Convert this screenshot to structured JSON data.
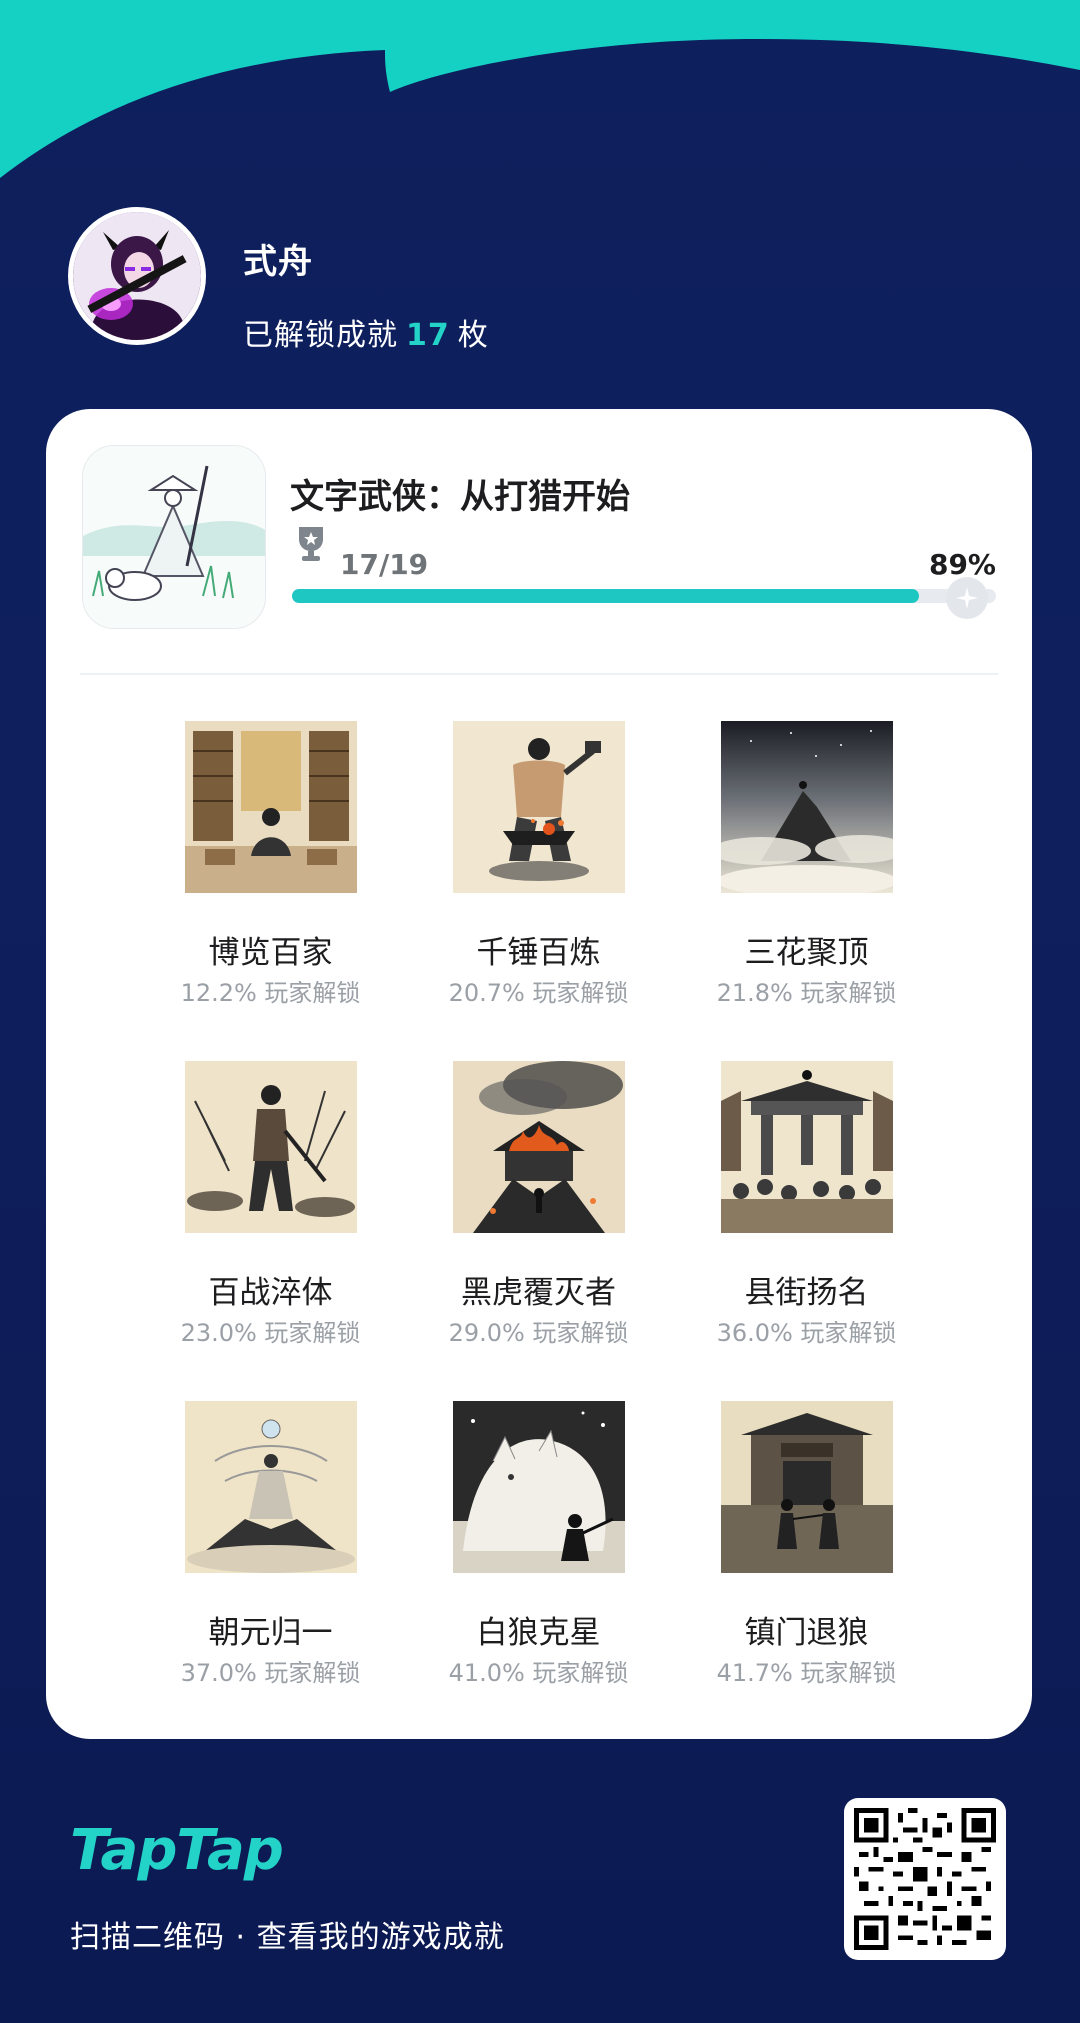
{
  "profile": {
    "username": "式舟",
    "unlocked_prefix": "已解锁成就",
    "unlocked_count": "17",
    "unlocked_suffix": "枚"
  },
  "game": {
    "title": "文字武侠：从打猎开始",
    "progress_text": "17/19",
    "progress_percent_text": "89%",
    "progress_fraction": 0.89
  },
  "achievements": [
    {
      "name": "博览百家",
      "rate": "12.2% 玩家解锁",
      "icon": "library-scholar-image"
    },
    {
      "name": "千锤百炼",
      "rate": "20.7% 玩家解锁",
      "icon": "blacksmith-image"
    },
    {
      "name": "三花聚顶",
      "rate": "21.8% 玩家解锁",
      "icon": "mountain-peak-image"
    },
    {
      "name": "百战淬体",
      "rate": "23.0% 玩家解锁",
      "icon": "battlefield-warrior-image"
    },
    {
      "name": "黑虎覆灭者",
      "rate": "29.0% 玩家解锁",
      "icon": "burning-fortress-image"
    },
    {
      "name": "县街扬名",
      "rate": "36.0% 玩家解锁",
      "icon": "town-gate-crowd-image"
    },
    {
      "name": "朝元归一",
      "rate": "37.0% 玩家解锁",
      "icon": "meditating-immortal-image"
    },
    {
      "name": "白狼克星",
      "rate": "41.0% 玩家解锁",
      "icon": "white-wolf-image"
    },
    {
      "name": "镇门退狼",
      "rate": "41.7% 玩家解锁",
      "icon": "gate-duel-image"
    }
  ],
  "footer": {
    "brand": "TapTap",
    "caption": "扫描二维码 · 查看我的游戏成就"
  },
  "colors": {
    "accent": "#23d3c8",
    "background": "#0f1f5e",
    "progress": "#1fc7c3"
  }
}
